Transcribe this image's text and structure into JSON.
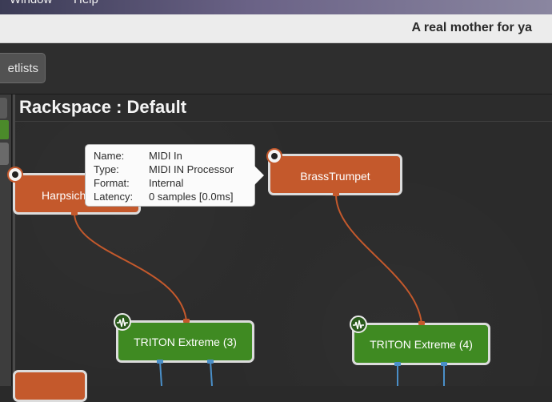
{
  "menubar": {
    "items": [
      "Window",
      "Help"
    ]
  },
  "window": {
    "title": "A real mother for ya"
  },
  "toolbar": {
    "setlists_label": "etlists"
  },
  "rackspace": {
    "header": "Rackspace : Default"
  },
  "tooltip": {
    "rows": [
      {
        "key": "Name:",
        "value": "MIDI In"
      },
      {
        "key": "Type:",
        "value": "MIDI IN Processor"
      },
      {
        "key": "Format:",
        "value": "Internal"
      },
      {
        "key": "Latency:",
        "value": "0 samples [0.0ms]"
      }
    ]
  },
  "nodes": {
    "harpsichord": {
      "label": "Harpsich",
      "kind": "midi",
      "color": "#c4592c"
    },
    "brass_trumpet": {
      "label": "BrassTrumpet",
      "kind": "midi",
      "color": "#c4592c"
    },
    "triton3": {
      "label": "TRITON Extreme (3)",
      "kind": "audio",
      "color": "#3f8a22"
    },
    "triton4": {
      "label": "TRITON Extreme (4)",
      "kind": "audio",
      "color": "#3f8a22"
    }
  },
  "colors": {
    "midi_wire": "#c4592c",
    "audio_wire": "#4a8fc8",
    "accent_green": "#4b8a2a"
  },
  "icons": [
    "midi-in-icon",
    "audio-wave-icon"
  ]
}
